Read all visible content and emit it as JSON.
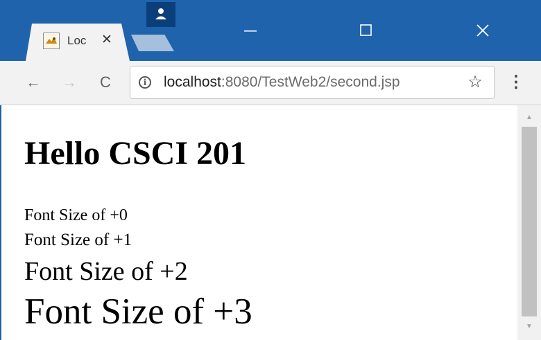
{
  "tab": {
    "title": "Loc",
    "close_glyph": "✕",
    "favicon": "tomcat-icon"
  },
  "window_controls": {
    "minimize": "—",
    "maximize": "☐",
    "close": "✕"
  },
  "toolbar": {
    "back": "←",
    "forward": "→",
    "reload": "C",
    "info": "i",
    "url_host": "localhost",
    "url_rest": ":8080/TestWeb2/second.jsp",
    "bookmark": "☆",
    "menu": "⋮"
  },
  "page": {
    "heading": "Hello CSCI 201",
    "lines": [
      "Font Size of +0",
      "Font Size of +1",
      "Font Size of +2",
      "Font Size of +3"
    ]
  },
  "scrollbar": {
    "up": "▲",
    "down": "▼"
  },
  "colors": {
    "titlebar": "#1f63ad",
    "tab": "#f2f2f2",
    "toolbar": "#f2f2f2"
  }
}
